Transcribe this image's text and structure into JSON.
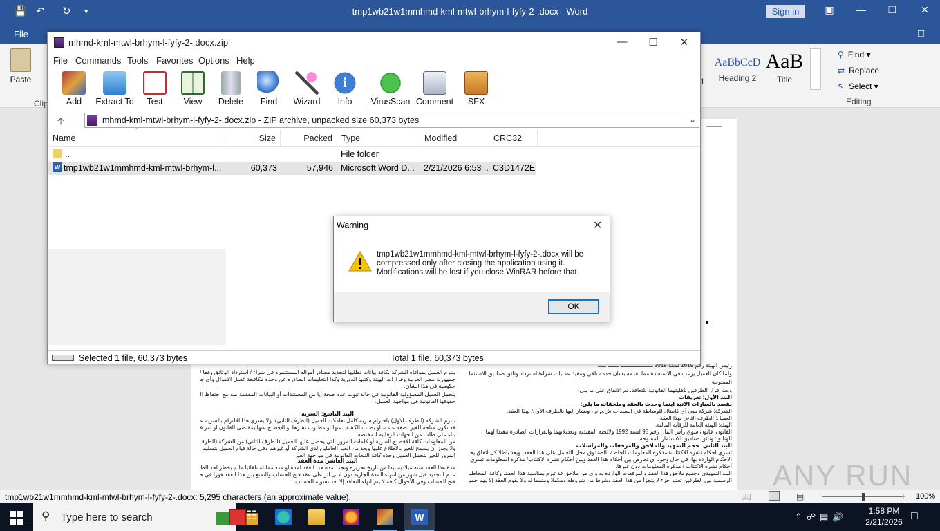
{
  "word": {
    "title": "tmp1wb21w1mmhmd-kml-mtwl-brhym-l-fyfy-2-.docx - Word",
    "signin": "Sign in",
    "file_tab": "File",
    "paste": "Paste",
    "clipboard_partial": "Clip",
    "styles": [
      {
        "sample": "AaBbCcD",
        "name": "Heading 2"
      },
      {
        "sample": "AaB",
        "name": "Title"
      }
    ],
    "style_partial_name": "1",
    "editing": {
      "find": "Find",
      "replace": "Replace",
      "select": "Select",
      "group": "Editing"
    },
    "status_text": "tmp1wb21w1mmhmd-kml-mtwl-brhym-l-fyfy-2-.docx: 5,295 characters (an approximate value).",
    "zoom": "100%"
  },
  "winrar": {
    "title": "mhmd-kml-mtwl-brhym-l-fyfy-2-.docx.zip",
    "menu": [
      "File",
      "Commands",
      "Tools",
      "Favorites",
      "Options",
      "Help"
    ],
    "toolbar": [
      "Add",
      "Extract To",
      "Test",
      "View",
      "Delete",
      "Find",
      "Wizard",
      "Info",
      "VirusScan",
      "Comment",
      "SFX"
    ],
    "address": "mhmd-kml-mtwl-brhym-l-fyfy-2-.docx.zip - ZIP archive, unpacked size 60,373 bytes",
    "columns": [
      "Name",
      "Size",
      "Packed",
      "Type",
      "Modified",
      "CRC32"
    ],
    "rows": [
      {
        "name": "..",
        "size": "",
        "packed": "",
        "type": "File folder",
        "modified": "",
        "crc": ""
      },
      {
        "name": "tmp1wb21w1mmhmd-kml-mtwl-brhym-l...",
        "size": "60,373",
        "packed": "57,946",
        "type": "Microsoft Word D...",
        "modified": "2/21/2026 6:53 ...",
        "crc": "C3D1472E"
      }
    ],
    "status_left": "Selected 1 file, 60,373 bytes",
    "status_right": "Total 1 file, 60,373 bytes"
  },
  "dialog": {
    "title": "Warning",
    "line1": "tmp1wb21w1mmhmd-kml-mtwl-brhym-l-fyfy-2-.docx will be",
    "line2": "compressed only after closing the application using it.",
    "line3": "Modifications will be lost if you close WinRAR before that.",
    "ok": "OK"
  },
  "taskbar": {
    "search_placeholder": "Type here to search",
    "time": "1:58 PM",
    "date": "2/21/2026"
  },
  "watermark": "ANY RUN",
  "colors": {
    "word_blue": "#2b579a",
    "taskbar": "#0c1424",
    "focus": "#0078d7"
  }
}
